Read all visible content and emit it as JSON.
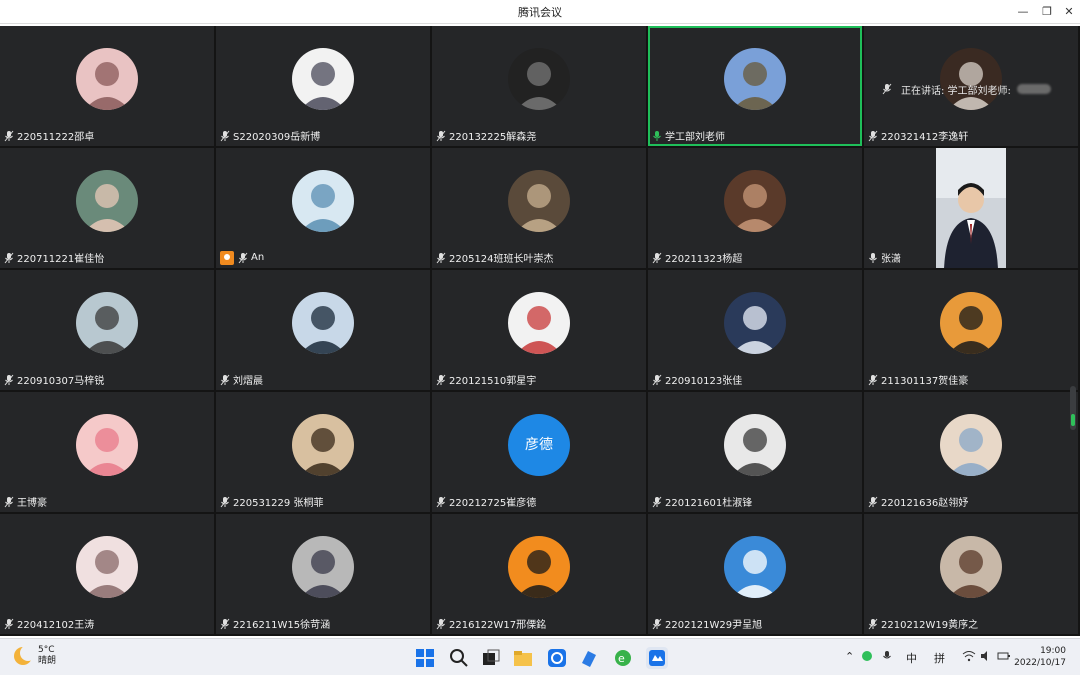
{
  "window": {
    "title": "腾讯会议"
  },
  "speaking": {
    "label": "正在讲话: 学工部刘老师:"
  },
  "participants": [
    {
      "name": "220511222邵卓",
      "colors": [
        "#e9c3c3",
        "#8a5a5a"
      ]
    },
    {
      "name": "S22020309岳新博",
      "colors": [
        "#f2f2f2",
        "#4a4a5a"
      ]
    },
    {
      "name": "220132225解森尧",
      "colors": [
        "#222222",
        "#777777"
      ]
    },
    {
      "name": "学工部刘老师",
      "colors": [
        "#7aa0d8",
        "#6a5a3a"
      ]
    },
    {
      "name": "220321412李逸轩",
      "colors": [
        "#3a2a22",
        "#d8d0c8"
      ]
    },
    {
      "name": "220711221崔佳怡",
      "colors": [
        "#6a8a7a",
        "#e8c8b8"
      ]
    },
    {
      "name": "An",
      "colors": [
        "#d8e8f2",
        "#5b8fb3"
      ]
    },
    {
      "name": "2205124班班长叶崇杰",
      "colors": [
        "#5a4a3a",
        "#c8b090"
      ]
    },
    {
      "name": "220211323杨超",
      "colors": [
        "#5a3a2a",
        "#c89878"
      ]
    },
    {
      "name": "张潇",
      "colors": [
        "#d8d8d8",
        "#2a2a3a"
      ]
    },
    {
      "name": "220910307马梓锐",
      "colors": [
        "#b8c8d0",
        "#3a3a3a"
      ]
    },
    {
      "name": "刘熠晨",
      "colors": [
        "#c8d8e8",
        "#1a2a3a"
      ]
    },
    {
      "name": "220121510郭星宇",
      "colors": [
        "#f2f2f2",
        "#c83a3a"
      ]
    },
    {
      "name": "220910123张佳",
      "colors": [
        "#2a3a5a",
        "#e8eef8"
      ]
    },
    {
      "name": "211301137贺佳豪",
      "colors": [
        "#e89a3a",
        "#1a1a1a"
      ]
    },
    {
      "name": "王博豪",
      "colors": [
        "#f5c9c9",
        "#e87a8a"
      ]
    },
    {
      "name": "220531229 张桐菲",
      "colors": [
        "#d8c0a0",
        "#3a2a1a"
      ]
    },
    {
      "name": "220212725崔彦德",
      "avatar_text": "彦德",
      "colors": [
        "#1e88e5",
        "#1e88e5"
      ]
    },
    {
      "name": "220121601杜淑锋",
      "colors": [
        "#e8e8e8",
        "#3a3a3a"
      ]
    },
    {
      "name": "220121636赵翎妤",
      "colors": [
        "#e8d8c8",
        "#8aa8c8"
      ]
    },
    {
      "name": "220412102王涛",
      "colors": [
        "#f0e0e0",
        "#8a6a6a"
      ]
    },
    {
      "name": "2216211W15徐苛涵",
      "colors": [
        "#b8b8b8",
        "#3a3a4a"
      ]
    },
    {
      "name": "2216122W17邢傈銘",
      "colors": [
        "#f28c1e",
        "#1a1a1a"
      ]
    },
    {
      "name": "2202121W29尹呈旭",
      "colors": [
        "#3a8ad8",
        "#ffffff"
      ]
    },
    {
      "name": "2210212W19黄序之",
      "colors": [
        "#c8b8a8",
        "#5a3a2a"
      ]
    }
  ],
  "icons": {
    "mic_muted": "mic-muted-icon",
    "mic_active": "mic-active-icon",
    "host": "host-badge-icon"
  },
  "colors": {
    "active_border": "#1fbf5a",
    "tile_bg": "#252628",
    "grid_bg": "#141414"
  },
  "taskbar": {
    "weather_temp": "5°C",
    "weather_desc": "晴朗",
    "ime_lang": "中",
    "ime_mode": "拼",
    "time": "19:00",
    "date": "2022/10/17"
  }
}
